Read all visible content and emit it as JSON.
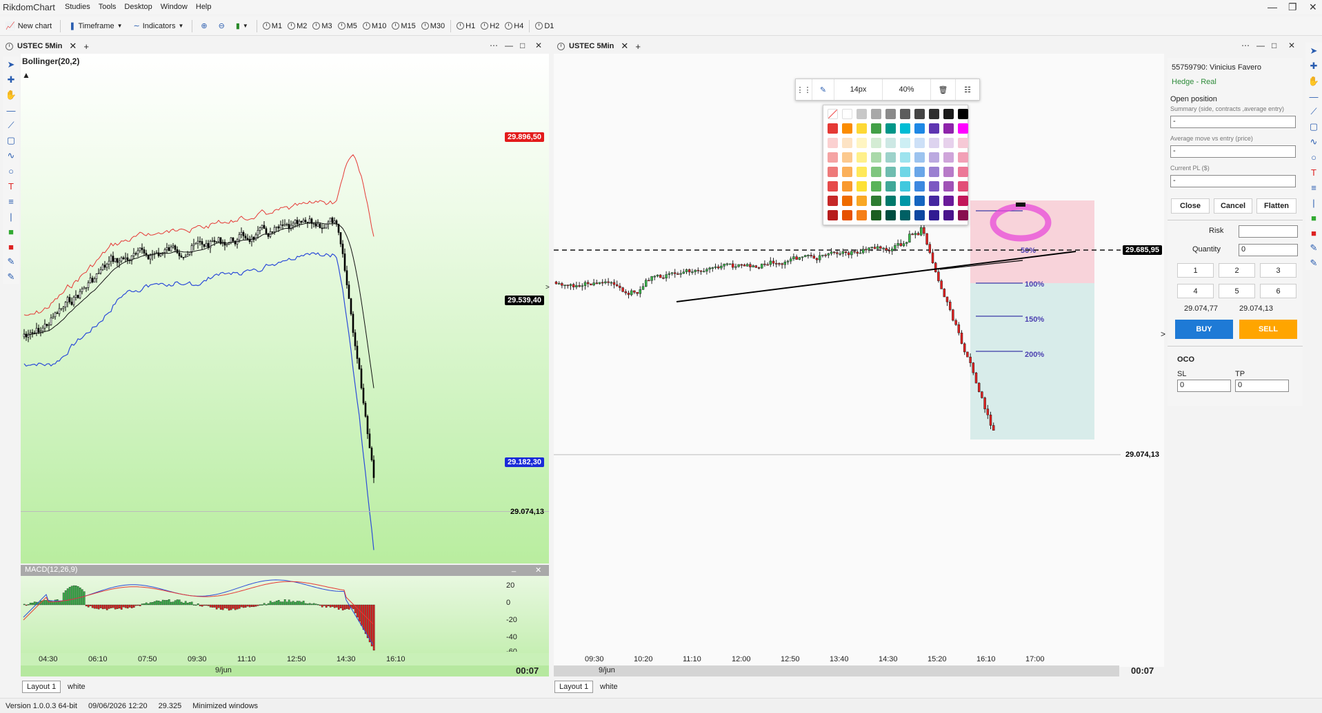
{
  "app": {
    "logo": "RikdomChart",
    "menu": [
      "Studies",
      "Tools",
      "Desktop",
      "Window",
      "Help"
    ]
  },
  "toolbar": {
    "new_chart": "New chart",
    "timeframe": "Timeframe",
    "indicators": "Indicators",
    "timeframes": [
      "M1",
      "M2",
      "M3",
      "M5",
      "M10",
      "M15",
      "M30",
      "H1",
      "H2",
      "H4",
      "D1"
    ]
  },
  "left_chart": {
    "title": "USTEC 5Min",
    "indicator": "Bollinger(20,2)",
    "price_tags": {
      "upper": "29.896,50",
      "current": "29.539,40",
      "lower": "29.182,30",
      "last": "29.074,13"
    },
    "macd": {
      "label": "MACD(12,26,9)",
      "ticks": [
        "20",
        "0",
        "-20",
        "-40",
        "-60"
      ]
    },
    "time_labels": [
      "04:30",
      "06:10",
      "07:50",
      "09:30",
      "11:10",
      "12:50",
      "14:30",
      "16:10"
    ],
    "date": "9/jun",
    "countdown": "00:07"
  },
  "right_chart": {
    "title": "USTEC 5Min",
    "price_tags": {
      "dashed": "29.685,95",
      "last": "29.074,13"
    },
    "fib_labels": [
      "100%",
      "150%",
      "200%",
      "50%"
    ],
    "time_labels": [
      "09:30",
      "10:20",
      "11:10",
      "12:00",
      "12:50",
      "13:40",
      "14:30",
      "15:20",
      "16:10",
      "17:00"
    ],
    "date": "9/jun",
    "countdown": "00:07"
  },
  "draw_toolbar": {
    "font_size": "14px",
    "opacity": "40%"
  },
  "palette_colors": [
    [
      "#ffffff",
      "#ffffff",
      "#c8c8c8",
      "#a8a8a8",
      "#8a8a8a",
      "#5c5c5c",
      "#444444",
      "#2e2e2e",
      "#1a1a1a",
      "#000000"
    ],
    [
      "#e53935",
      "#fb8c00",
      "#fdd835",
      "#43a047",
      "#009688",
      "#00bcd4",
      "#1e88e5",
      "#5e35b1",
      "#8e24aa",
      "#ff00ff"
    ],
    [
      "#fbd0d0",
      "#fde3c4",
      "#fff5c2",
      "#d4ecd4",
      "#cde8e4",
      "#cdeff4",
      "#cde0f7",
      "#ddd3ef",
      "#e7d1ec",
      "#f6c9d6"
    ],
    [
      "#f5a3a3",
      "#fcc98e",
      "#fff08a",
      "#a9d9a9",
      "#9dd2ca",
      "#9de3ee",
      "#9cc3ef",
      "#bba9e0",
      "#cfa5da",
      "#f2a0b6"
    ],
    [
      "#ee7a7a",
      "#fbb05a",
      "#ffe95a",
      "#7fc67f",
      "#6fbdb0",
      "#6fd6e6",
      "#6aa6e8",
      "#9a80d1",
      "#b87bc8",
      "#ec7897"
    ],
    [
      "#e64a4a",
      "#f9992e",
      "#fde135",
      "#58b358",
      "#40a898",
      "#40c8de",
      "#3c88e0",
      "#7b58c2",
      "#a052b6",
      "#e24d77"
    ],
    [
      "#c62828",
      "#ef6c00",
      "#f9a825",
      "#2e7d32",
      "#00796b",
      "#0097a7",
      "#1565c0",
      "#4527a0",
      "#6a1b9a",
      "#c2185b"
    ],
    [
      "#b71c1c",
      "#e65100",
      "#f57f17",
      "#1b5e20",
      "#004d40",
      "#006064",
      "#0d47a1",
      "#311b92",
      "#4a148c",
      "#880e4f"
    ]
  ],
  "order_panel": {
    "account": "55759790: Vinicius Favero",
    "account_type": "Hedge - Real",
    "open_position": "Open position",
    "summary_label": "Summary (side, contracts ,average entry)",
    "summary_value": "-",
    "avg_move_label": "Average move vs entry (price)",
    "avg_move_value": "-",
    "pl_label": "Current PL ($)",
    "pl_value": "-",
    "close": "Close",
    "cancel": "Cancel",
    "flatten": "Flatten",
    "risk_label": "Risk",
    "risk_value": "",
    "quantity_label": "Quantity",
    "quantity_value": "0",
    "numbers": [
      "1",
      "2",
      "3",
      "4",
      "5",
      "6"
    ],
    "bid": "29.074,77",
    "ask": "29.074,13",
    "buy": "BUY",
    "sell": "SELL",
    "oco": "OCO",
    "sl_label": "SL",
    "sl_value": "0",
    "tp_label": "TP",
    "tp_value": "0"
  },
  "tabs": {
    "layout": "Layout 1",
    "white": "white"
  },
  "status": {
    "version": "Version 1.0.0.3 64-bit",
    "datetime": "09/06/2026 12:20",
    "value": "29.325",
    "windows": "Minimized windows"
  },
  "colors": {
    "accent": "#2a5db0",
    "buy": "#1e7ad6",
    "sell": "#ffa500",
    "bull": "#3ab54a",
    "bear": "#e02020",
    "bb_upper": "#e53935",
    "bb_lower": "#2b4bd8"
  }
}
